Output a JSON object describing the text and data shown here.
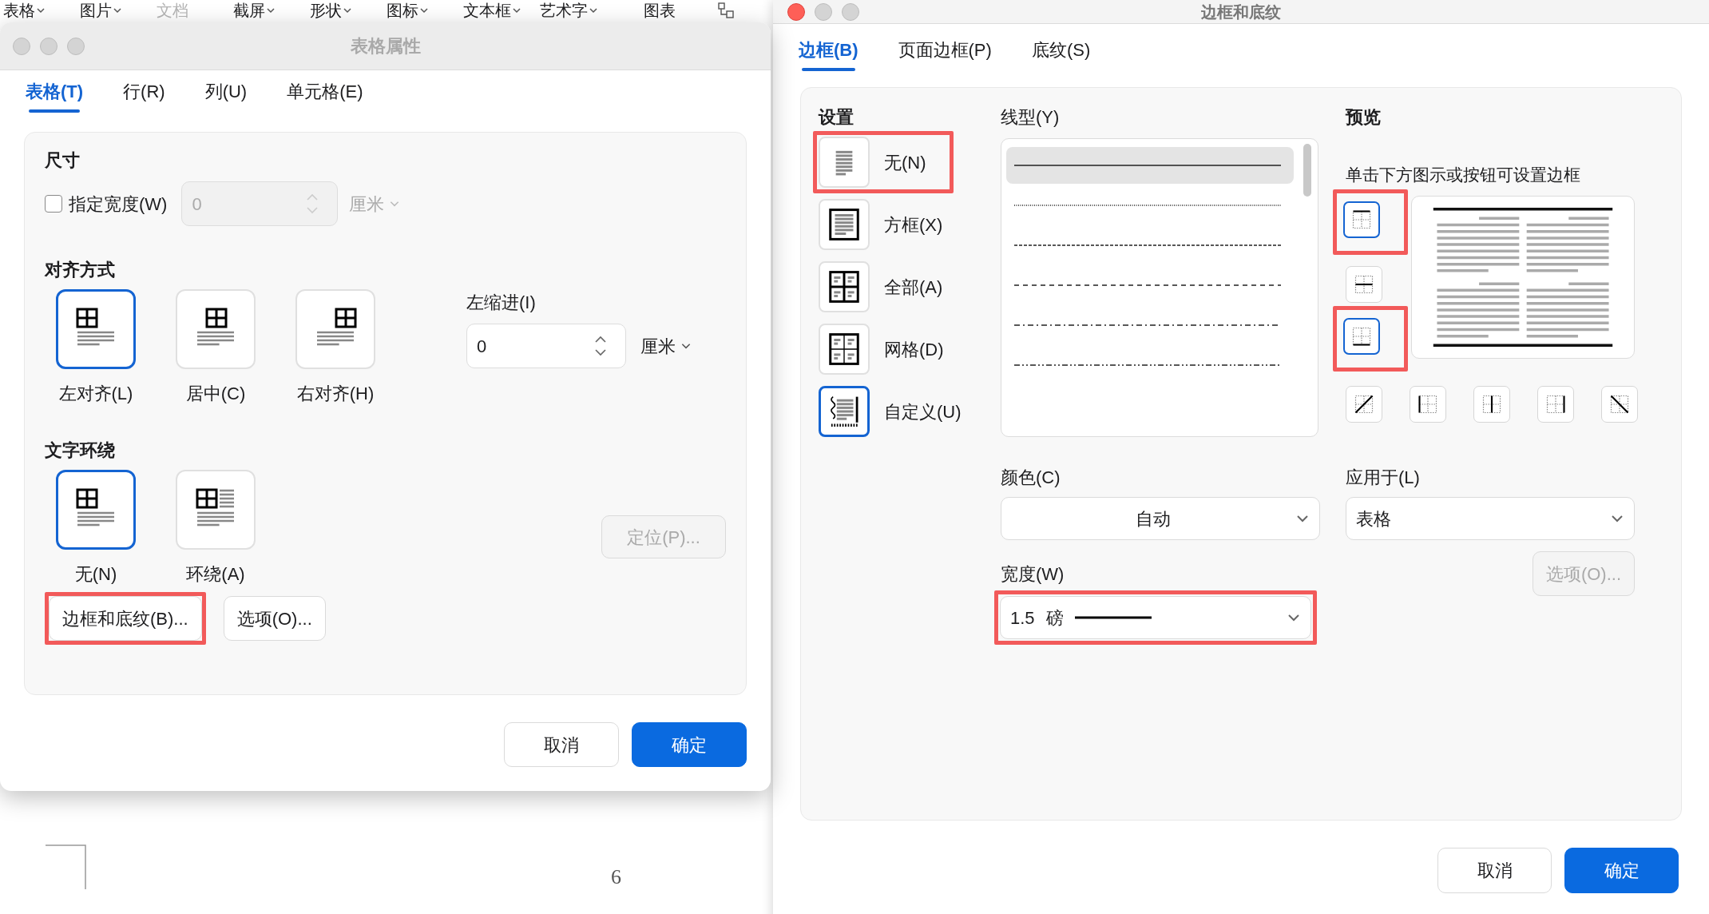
{
  "menubar": {
    "items": [
      {
        "label": "表格",
        "dropdown": true,
        "disabled": false
      },
      {
        "label": "图片",
        "dropdown": true,
        "disabled": false
      },
      {
        "label": "文档",
        "dropdown": false,
        "disabled": true
      },
      {
        "label": "截屏",
        "dropdown": true,
        "disabled": false
      },
      {
        "label": "形状",
        "dropdown": true,
        "disabled": false
      },
      {
        "label": "图标",
        "dropdown": true,
        "disabled": false
      },
      {
        "label": "文本框",
        "dropdown": true,
        "disabled": false
      },
      {
        "label": "艺术字",
        "dropdown": true,
        "disabled": false
      },
      {
        "label": "图表",
        "dropdown": false,
        "disabled": false
      }
    ]
  },
  "table_properties": {
    "title": "表格属性",
    "tabs": [
      {
        "label": "表格(T)",
        "selected": true
      },
      {
        "label": "行(R)",
        "selected": false
      },
      {
        "label": "列(U)",
        "selected": false
      },
      {
        "label": "单元格(E)",
        "selected": false
      }
    ],
    "size": {
      "heading": "尺寸",
      "specify_width": {
        "label": "指定宽度(W)",
        "checked": false
      },
      "width_field": {
        "value": "0",
        "disabled": true
      },
      "unit": {
        "value": "厘米",
        "disabled": true
      }
    },
    "alignment": {
      "heading": "对齐方式",
      "options": [
        {
          "label": "左对齐(L)",
          "kind": "left",
          "selected": true
        },
        {
          "label": "居中(C)",
          "kind": "center",
          "selected": false
        },
        {
          "label": "右对齐(H)",
          "kind": "right",
          "selected": false
        }
      ],
      "indent": {
        "label": "左缩进(I)",
        "value": "0",
        "unit": "厘米"
      }
    },
    "wrapping": {
      "heading": "文字环绕",
      "options": [
        {
          "label": "无(N)",
          "kind": "none",
          "selected": true
        },
        {
          "label": "环绕(A)",
          "kind": "around",
          "selected": false
        }
      ],
      "position_button": {
        "label": "定位(P)...",
        "disabled": true
      }
    },
    "buttons": [
      {
        "label": "边框和底纹(B)...",
        "highlighted": true
      },
      {
        "label": "选项(O)...",
        "highlighted": false
      }
    ],
    "footer_buttons": [
      {
        "label": "取消",
        "primary": false
      },
      {
        "label": "确定",
        "primary": true
      }
    ]
  },
  "page": {
    "page_number": "6"
  },
  "borders_and_shading": {
    "title": "边框和底纹",
    "tabs": [
      {
        "label": "边框(B)",
        "selected": true
      },
      {
        "label": "页面边框(P)",
        "selected": false
      },
      {
        "label": "底纹(S)",
        "selected": false
      }
    ],
    "setting": {
      "heading": "设置",
      "options": [
        {
          "label": "无(N)",
          "kind": "none",
          "selected": false,
          "highlighted": true
        },
        {
          "label": "方框(X)",
          "kind": "box",
          "selected": false,
          "highlighted": false
        },
        {
          "label": "全部(A)",
          "kind": "all",
          "selected": false,
          "highlighted": false
        },
        {
          "label": "网格(D)",
          "kind": "grid",
          "selected": false,
          "highlighted": false
        },
        {
          "label": "自定义(U)",
          "kind": "custom",
          "selected": true,
          "highlighted": false
        }
      ]
    },
    "line_style": {
      "label": "线型(Y)",
      "styles": [
        {
          "kind": "solid",
          "selected": true
        },
        {
          "kind": "dotted",
          "selected": false
        },
        {
          "kind": "dashed",
          "selected": false
        },
        {
          "kind": "long-dash",
          "selected": false
        },
        {
          "kind": "dash-dot",
          "selected": false
        },
        {
          "kind": "dash-dot-dot",
          "selected": false
        }
      ]
    },
    "preview": {
      "heading": "预览",
      "hint": "单击下方图示或按钮可设置边框",
      "side_buttons": [
        {
          "kind": "top",
          "on": true,
          "highlighted": true
        },
        {
          "kind": "middle",
          "on": false,
          "highlighted": false
        },
        {
          "kind": "bottom",
          "on": true,
          "highlighted": true
        }
      ],
      "bottom_buttons": [
        {
          "kind": "diag-up",
          "on": false
        },
        {
          "kind": "left",
          "on": false
        },
        {
          "kind": "center",
          "on": false
        },
        {
          "kind": "right",
          "on": false
        },
        {
          "kind": "diag-down",
          "on": false
        }
      ]
    },
    "color": {
      "label": "颜色(C)",
      "value": "自动"
    },
    "apply_to": {
      "label": "应用于(L)",
      "value": "表格"
    },
    "width": {
      "label": "宽度(W)",
      "value": "1.5",
      "unit": "磅",
      "highlighted": true
    },
    "options_button": {
      "label": "选项(O)...",
      "disabled": true
    },
    "footer_buttons": [
      {
        "label": "取消",
        "primary": false
      },
      {
        "label": "确定",
        "primary": true
      }
    ]
  }
}
